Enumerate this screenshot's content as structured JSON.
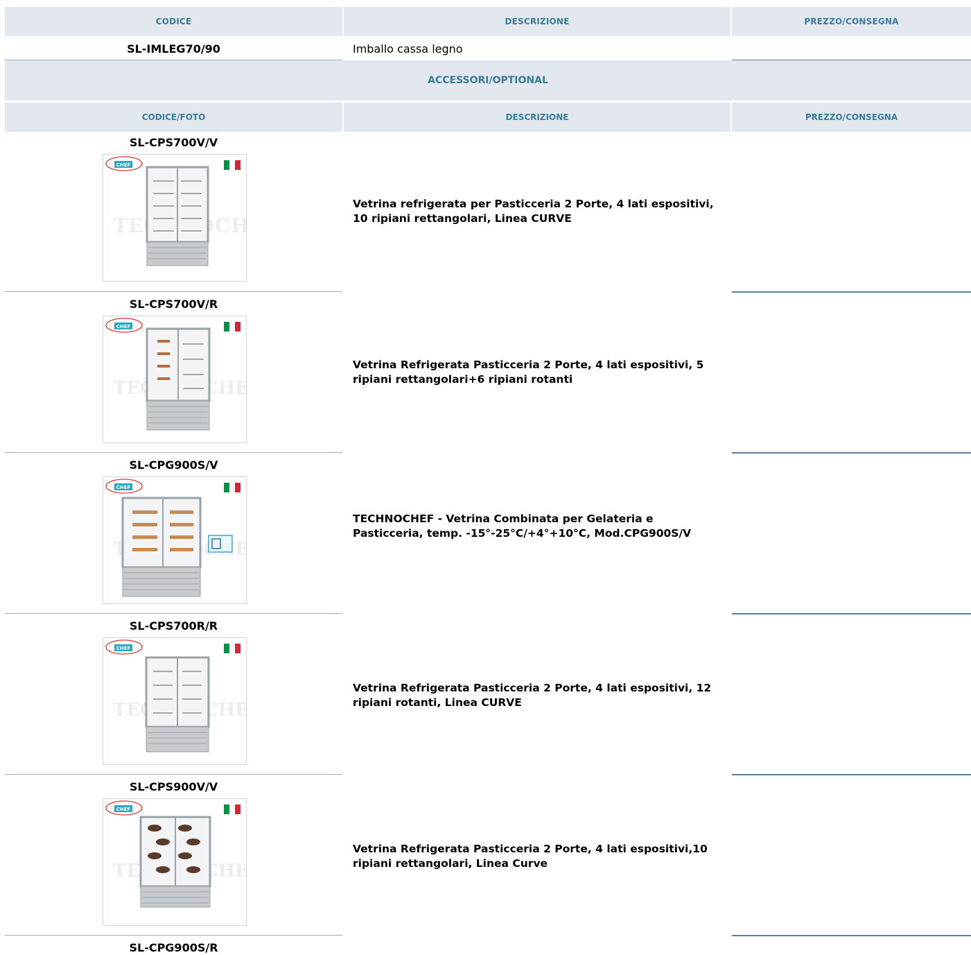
{
  "header": {
    "codice": "CODICE",
    "descrizione": "DESCRIZIONE",
    "prezzo": "PREZZO/CONSEGNA"
  },
  "packaging_row": {
    "code": "SL-IMLEG70/90",
    "description": "Imballo cassa legno"
  },
  "section": {
    "title": "ACCESSORI/OPTIONAL",
    "col_code": "CODICE/FOTO",
    "col_desc": "DESCRIZIONE",
    "col_price": "PREZZO/CONSEGNA"
  },
  "products": [
    {
      "code": "SL-CPS700V/V",
      "description": "Vetrina refrigerata per Pasticceria 2 Porte, 4 lati espositivi, 10 ripiani rettangolari, Linea CURVE",
      "image": "display-case-rect-shelves"
    },
    {
      "code": "SL-CPS700V/R",
      "description": "Vetrina Refrigerata Pasticceria 2 Porte, 4 lati espositivi, 5 ripiani rettangolari+6 ripiani rotanti",
      "image": "display-case-mixed-shelves"
    },
    {
      "code": "SL-CPG900S/V",
      "description": "TECHNOCHEF - Vetrina Combinata per Gelateria e Pasticceria, temp. -15°-25°C/+4°+10°C, Mod.CPG900S/V",
      "image": "combined-display-case"
    },
    {
      "code": "SL-CPS700R/R",
      "description": "Vetrina Refrigerata Pasticceria 2 Porte, 4 lati espositivi, 12 ripiani rotanti, Linea CURVE",
      "image": "display-case-rotating-shelves"
    },
    {
      "code": "SL-CPS900V/V",
      "description": "Vetrina Refrigerata Pasticceria 2 Porte, 4 lati espositivi,10 ripiani rettangolari, Linea Curve",
      "image": "display-case-cakes"
    },
    {
      "code": "SL-CPG900S/R",
      "description": "",
      "image": ""
    }
  ],
  "brand": {
    "logo_text_top": "TECHNO",
    "logo_text_bottom": "CHEF",
    "watermark": "TECHNOCHEF.IT"
  },
  "colors": {
    "header_bg": "#e2e8ee",
    "header_text": "#3a7d99",
    "divider": "#5a7f92",
    "flag_green": "#009246",
    "flag_red": "#ce2b37"
  }
}
